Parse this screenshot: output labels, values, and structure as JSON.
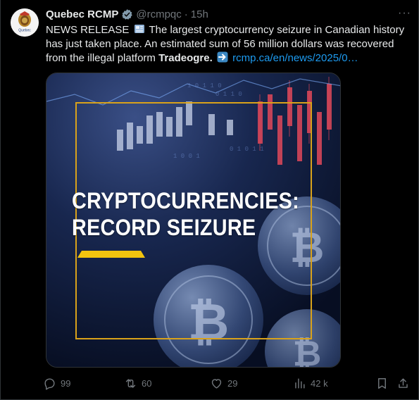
{
  "author": {
    "name": "Quebec RCMP",
    "handle": "@rcmpqc",
    "separator": "·",
    "time": "15h",
    "avatar_label": "Quebec"
  },
  "tweet": {
    "prefix": "NEWS RELEASE",
    "body_1": " The largest cryptocurrency seizure in Canadian history has just taken place. An estimated sum of 56 million dollars was recovered from the illegal platform ",
    "bold": "Tradeogre.",
    "link": "rcmp.ca/en/news/2025/0…"
  },
  "media": {
    "headline_line1": "CRYPTOCURRENCIES:",
    "headline_line2": "RECORD SEIZURE",
    "accent_color": "#f2c40f",
    "frame_color": "#d9a21a"
  },
  "actions": {
    "replies": "99",
    "reposts": "60",
    "likes": "29",
    "views": "42 k"
  },
  "colors": {
    "link": "#1d9bf0",
    "muted": "#71767b",
    "text": "#e7e9ea"
  }
}
